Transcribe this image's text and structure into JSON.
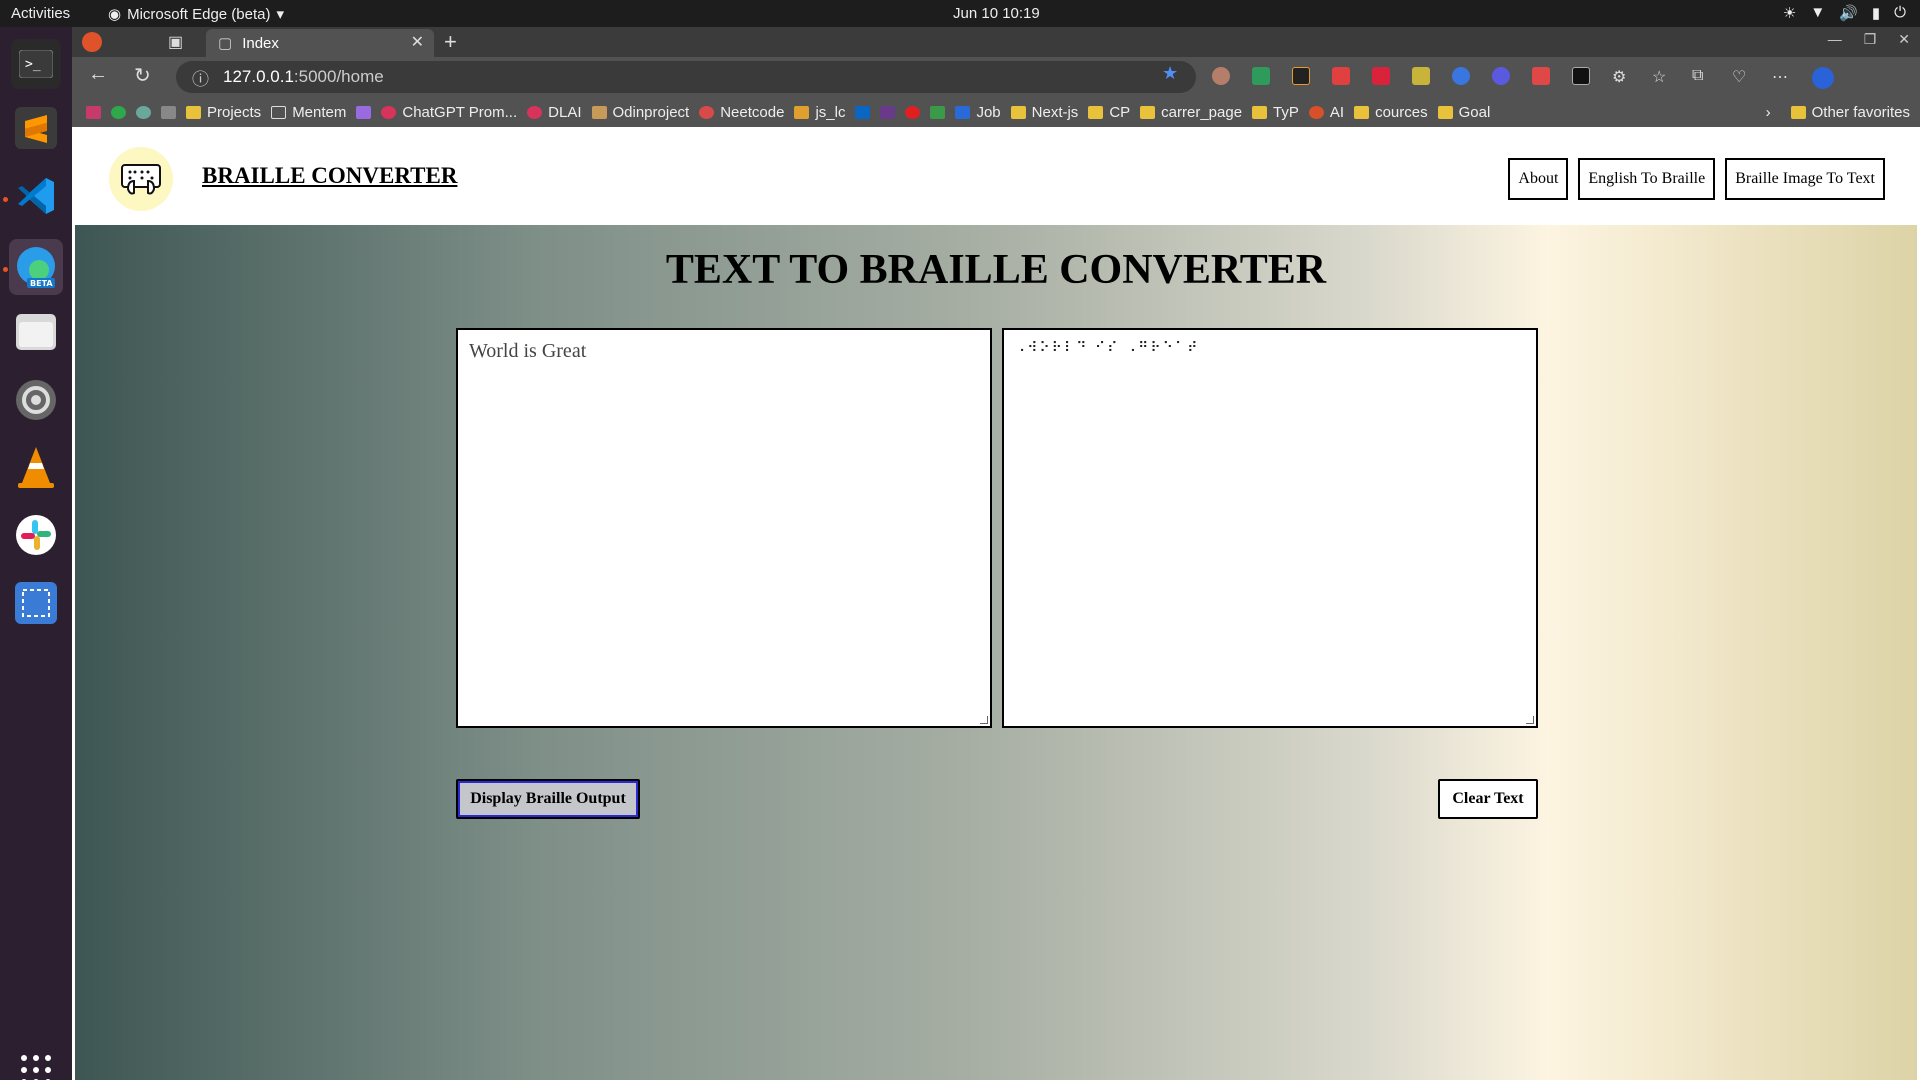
{
  "system": {
    "activities": "Activities",
    "app_name": "Microsoft Edge (beta)",
    "clock": "Jun 10  10:19"
  },
  "browser": {
    "tab_title": "Index",
    "url_host": "127.0.0.1",
    "url_path": ":5000/home",
    "bookmarks": [
      "Projects",
      "Mentem",
      "ChatGPT Prom...",
      "DLAI",
      "Odinproject",
      "Neetcode",
      "js_lc",
      "Job",
      "Next-js",
      "CP",
      "carrer_page",
      "TyP",
      "AI",
      "cources",
      "Goal"
    ],
    "other_favorites": "Other favorites"
  },
  "site": {
    "brand": "BRAILLE CONVERTER",
    "nav": [
      "About",
      "English To Braille",
      "Braille Image To Text"
    ],
    "title": "TEXT TO BRAILLE CONVERTER",
    "input_text": "World is Great",
    "output_text": "⠠⠺⠕⠗⠇⠙ ⠊⠎ ⠠⠛⠗⠑⠁⠞",
    "display_button": "Display Braille Output",
    "clear_button": "Clear Text"
  },
  "colors": {
    "gradient_left": "#3e5653",
    "gradient_mid": "#fdf4e1",
    "gradient_right": "#ddd3a7",
    "logo_bg": "#fdf7c2",
    "focus_outline": "#2a2ad0"
  }
}
